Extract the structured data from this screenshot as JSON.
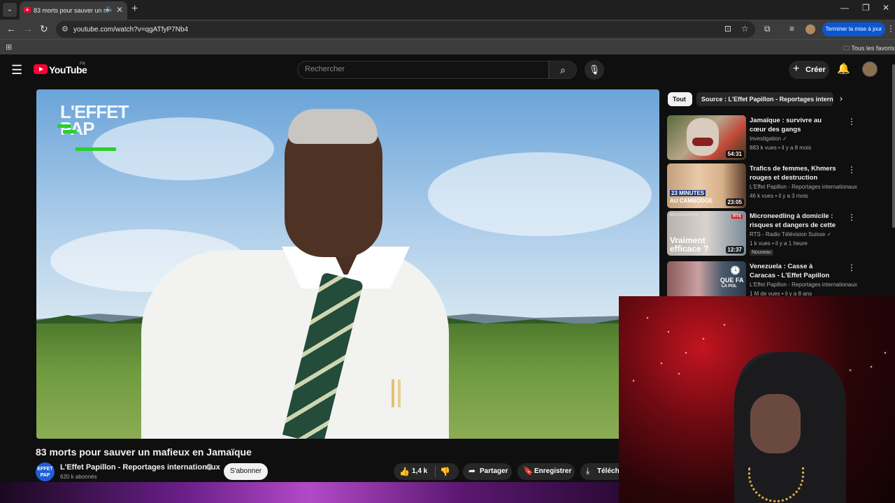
{
  "browser": {
    "tab_title": "83 morts pour sauver un m",
    "url": "youtube.com/watch?v=qgATfyP7Nb4",
    "update_button": "Terminer la mise à jour",
    "bookmarks_all": "Tous les favoris"
  },
  "youtube": {
    "logo_text": "YouTube",
    "country_code": "FR",
    "search_placeholder": "Rechercher",
    "create_label": "Créer"
  },
  "video": {
    "title": "83 morts pour sauver un mafieux en Jamaïque",
    "overlay_logo": "L'EFFET PAP",
    "channel": {
      "name": "L'Effet Papillon - Reportages internationaux",
      "subscribers": "620 k abonnés",
      "avatar_text": "EFFET PAP"
    },
    "subscribe_label": "S'abonner",
    "like_count": "1,4 k",
    "share_label": "Partager",
    "save_label": "Enregistrer",
    "download_label": "Téléchar"
  },
  "sidebar": {
    "chips": [
      "Tout",
      "Source : L'Effet Papillon - Reportages internationaux"
    ],
    "recommendations": [
      {
        "title": "Jamaïque : survivre au cœur des gangs",
        "channel": "Investigation",
        "verified": true,
        "views": "883 k vues",
        "age": "il y a 8 mois",
        "duration": "54:31",
        "badge": ""
      },
      {
        "title": "Trafics de femmes, Khmers rouges et destruction massive...",
        "channel": "L'Effet Papillon - Reportages internationaux",
        "verified": false,
        "views": "46 k vues",
        "age": "il y a 3 mois",
        "duration": "23:05",
        "badge": "",
        "thumb_text_1": "23 MINUTES",
        "thumb_text_2": "AU CAMBODGE"
      },
      {
        "title": "Microneedling à domicile : risques et dangers de cette ...",
        "channel": "RTS - Radio Télévision Suisse",
        "verified": true,
        "views": "1 k vues",
        "age": "il y a 1 heure",
        "duration": "12:37",
        "badge": "Nouveau",
        "thumb_text_1": "Microneedling",
        "thumb_text_2": "Vraiment efficace ?",
        "thumb_tag": "RTS"
      },
      {
        "title": "Venezuela : Casse à Caracas - L'Effet Papillon",
        "channel": "L'Effet Papillon - Reportages internationaux",
        "verified": false,
        "views": "1 M de vues",
        "age": "il y a 8 ans",
        "duration": "",
        "badge": "",
        "thumb_text_1": "QUE FA",
        "thumb_text_2": "LA POL"
      }
    ]
  },
  "colors": {
    "youtube_red": "#ff0033",
    "accent_blue": "#0b57d0",
    "logo_green": "#2bd02b"
  }
}
